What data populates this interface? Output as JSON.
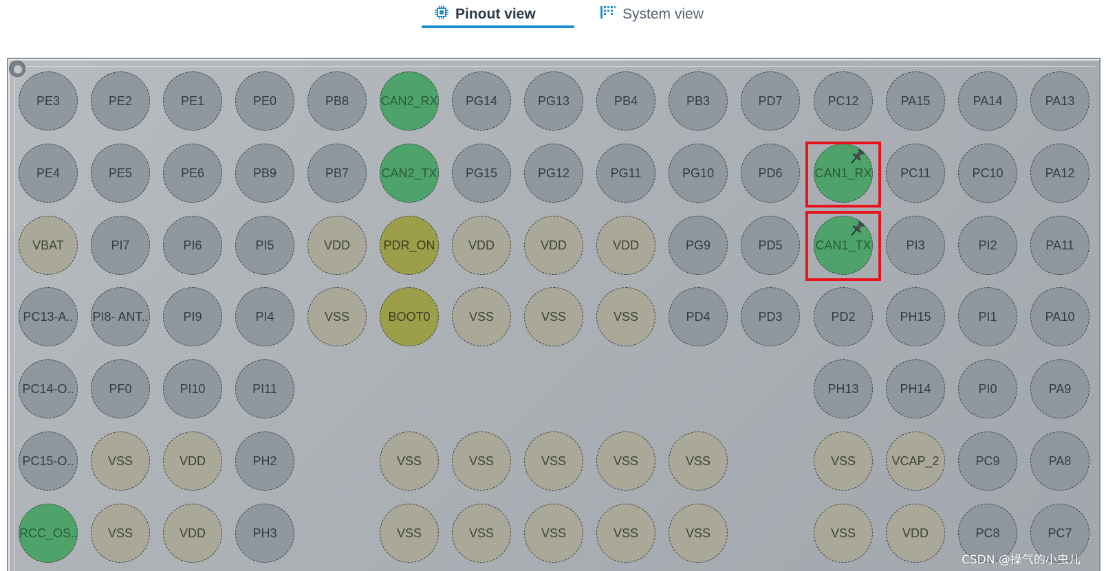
{
  "tabs": {
    "pinout_label": "Pinout view",
    "system_label": "System view"
  },
  "colors": {
    "gray_pin": "#8f979f",
    "power_pin": "#aaa898",
    "boot_pin": "#9c9e4a",
    "assigned_pin": "#4ea36a",
    "highlight": "#e8121c",
    "tab_underline": "#1e8fd4"
  },
  "pins": [
    [
      "PE3",
      "PE2",
      "PE1",
      "PE0",
      "PB8",
      "CAN2_RX",
      "PG14",
      "PG13",
      "PB4",
      "PB3",
      "PD7",
      "PC12",
      "PA15",
      "PA14",
      "PA13"
    ],
    [
      "PE4",
      "PE5",
      "PE6",
      "PB9",
      "PB7",
      "CAN2_TX",
      "PG15",
      "PG12",
      "PG11",
      "PG10",
      "PD6",
      "CAN1_RX",
      "PC11",
      "PC10",
      "PA12"
    ],
    [
      "VBAT",
      "PI7",
      "PI6",
      "PI5",
      "VDD",
      "PDR_ON",
      "VDD",
      "VDD",
      "VDD",
      "PG9",
      "PD5",
      "CAN1_TX",
      "PI3",
      "PI2",
      "PA11"
    ],
    [
      "PC13-A..",
      "PI8- ANT..",
      "PI9",
      "PI4",
      "VSS",
      "BOOT0",
      "VSS",
      "VSS",
      "VSS",
      "PD4",
      "PD3",
      "PD2",
      "PH15",
      "PI1",
      "PA10"
    ],
    [
      "PC14-O..",
      "PF0",
      "PI10",
      "PI11",
      "",
      "",
      "",
      "",
      "",
      "",
      "",
      "PH13",
      "PH14",
      "PI0",
      "PA9"
    ],
    [
      "PC15-O..",
      "VSS",
      "VDD",
      "PH2",
      "",
      "VSS",
      "VSS",
      "VSS",
      "VSS",
      "VSS",
      "",
      "VSS",
      "VCAP_2",
      "PC9",
      "PA8"
    ],
    [
      "RCC_OS..",
      "VSS",
      "VDD",
      "PH3",
      "",
      "VSS",
      "VSS",
      "VSS",
      "VSS",
      "VSS",
      "",
      "VSS",
      "VDD",
      "PC8",
      "PC7"
    ]
  ],
  "watermark": "CSDN @操气的小虫儿"
}
